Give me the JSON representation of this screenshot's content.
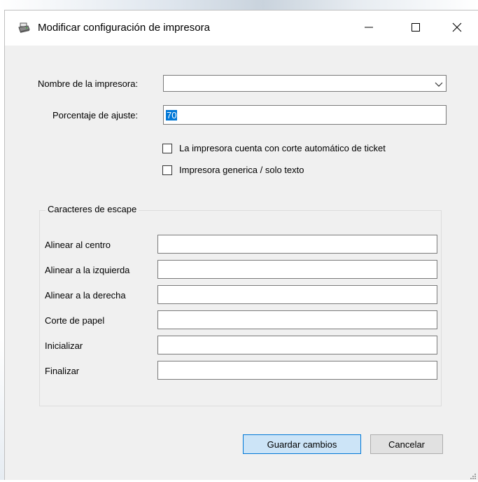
{
  "window": {
    "title": "Modificar configuración de impresora",
    "icon": "printer-icon"
  },
  "form": {
    "printer_name_label": "Nombre de la impresora:",
    "printer_name_value": "",
    "percentage_label": "Porcentaje de ajuste:",
    "percentage_value": "70",
    "auto_cut_label": "La impresora cuenta con corte automático de ticket",
    "auto_cut_checked": false,
    "generic_label": "Impresora generica / solo texto",
    "generic_checked": false
  },
  "escape_group": {
    "title": "Caracteres de escape",
    "fields": [
      {
        "label": "Alinear al centro",
        "value": ""
      },
      {
        "label": "Alinear a la izquierda",
        "value": ""
      },
      {
        "label": "Alinear a la derecha",
        "value": ""
      },
      {
        "label": "Corte de papel",
        "value": ""
      },
      {
        "label": "Inicializar",
        "value": ""
      },
      {
        "label": "Finalizar",
        "value": ""
      }
    ]
  },
  "buttons": {
    "save": "Guardar cambios",
    "cancel": "Cancelar"
  },
  "colors": {
    "accent": "#0078d7",
    "save_bg": "#cce4f7",
    "window_bg": "#f0f0f0"
  }
}
